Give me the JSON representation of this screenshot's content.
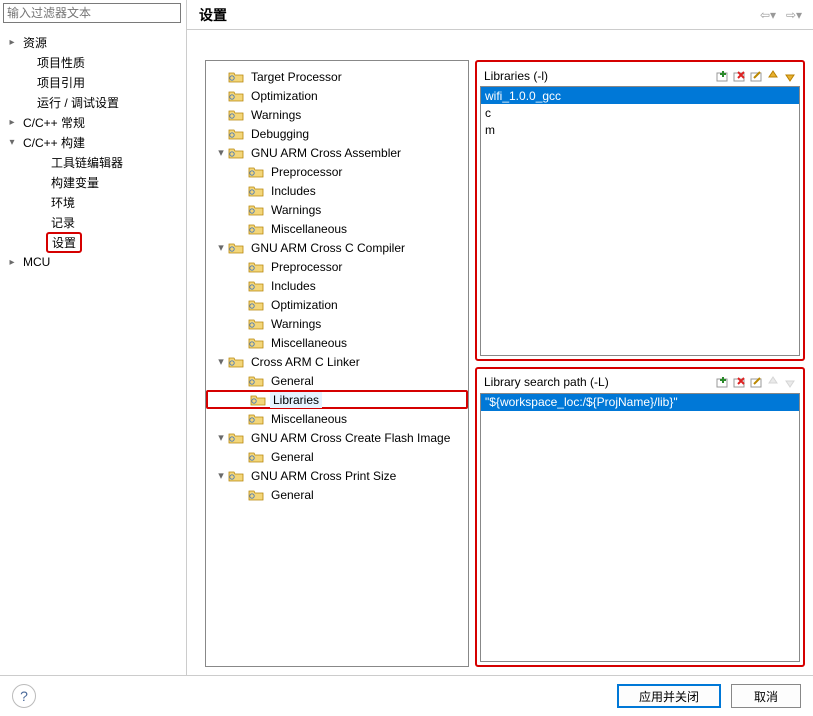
{
  "filter_placeholder": "输入过滤器文本",
  "right_title": "设置",
  "left_tree": [
    {
      "ind": 0,
      "tw": "▸",
      "label": "资源"
    },
    {
      "ind": 1,
      "tw": "",
      "label": "项目性质"
    },
    {
      "ind": 1,
      "tw": "",
      "label": "项目引用"
    },
    {
      "ind": 1,
      "tw": "",
      "label": "运行 / 调试设置"
    },
    {
      "ind": 0,
      "tw": "▸",
      "label": "C/C++ 常规"
    },
    {
      "ind": 0,
      "tw": "▾",
      "label": "C/C++ 构建"
    },
    {
      "ind": 2,
      "tw": "",
      "label": "工具链编辑器"
    },
    {
      "ind": 2,
      "tw": "",
      "label": "构建变量"
    },
    {
      "ind": 2,
      "tw": "",
      "label": "环境"
    },
    {
      "ind": 2,
      "tw": "",
      "label": "记录"
    },
    {
      "ind": 2,
      "tw": "",
      "label": "设置",
      "sel": true
    },
    {
      "ind": 0,
      "tw": "▸",
      "label": "MCU"
    }
  ],
  "settings_tree": [
    {
      "ind": 0,
      "tw": "",
      "label": "Target Processor"
    },
    {
      "ind": 0,
      "tw": "",
      "label": "Optimization"
    },
    {
      "ind": 0,
      "tw": "",
      "label": "Warnings"
    },
    {
      "ind": 0,
      "tw": "",
      "label": "Debugging"
    },
    {
      "ind": 0,
      "tw": "▾",
      "label": "GNU ARM Cross Assembler"
    },
    {
      "ind": 1,
      "tw": "",
      "label": "Preprocessor"
    },
    {
      "ind": 1,
      "tw": "",
      "label": "Includes"
    },
    {
      "ind": 1,
      "tw": "",
      "label": "Warnings"
    },
    {
      "ind": 1,
      "tw": "",
      "label": "Miscellaneous"
    },
    {
      "ind": 0,
      "tw": "▾",
      "label": "GNU ARM Cross C Compiler"
    },
    {
      "ind": 1,
      "tw": "",
      "label": "Preprocessor"
    },
    {
      "ind": 1,
      "tw": "",
      "label": "Includes"
    },
    {
      "ind": 1,
      "tw": "",
      "label": "Optimization"
    },
    {
      "ind": 1,
      "tw": "",
      "label": "Warnings"
    },
    {
      "ind": 1,
      "tw": "",
      "label": "Miscellaneous"
    },
    {
      "ind": 0,
      "tw": "▾",
      "label": "Cross ARM C Linker"
    },
    {
      "ind": 1,
      "tw": "",
      "label": "General"
    },
    {
      "ind": 1,
      "tw": "",
      "label": "Libraries",
      "sel": true
    },
    {
      "ind": 1,
      "tw": "",
      "label": "Miscellaneous"
    },
    {
      "ind": 0,
      "tw": "▾",
      "label": "GNU ARM Cross Create Flash Image"
    },
    {
      "ind": 1,
      "tw": "",
      "label": "General"
    },
    {
      "ind": 0,
      "tw": "▾",
      "label": "GNU ARM Cross Print Size"
    },
    {
      "ind": 1,
      "tw": "",
      "label": "General"
    }
  ],
  "libs_panel": {
    "title": "Libraries (-l)",
    "items": [
      {
        "text": "wifi_1.0.0_gcc",
        "selected": true
      },
      {
        "text": "c"
      },
      {
        "text": "m"
      }
    ]
  },
  "paths_panel": {
    "title": "Library search path (-L)",
    "items": [
      {
        "text": "\"${workspace_loc:/${ProjName}/lib}\"",
        "selected": true
      }
    ]
  },
  "buttons": {
    "apply_close": "应用并关闭",
    "cancel": "取消"
  }
}
